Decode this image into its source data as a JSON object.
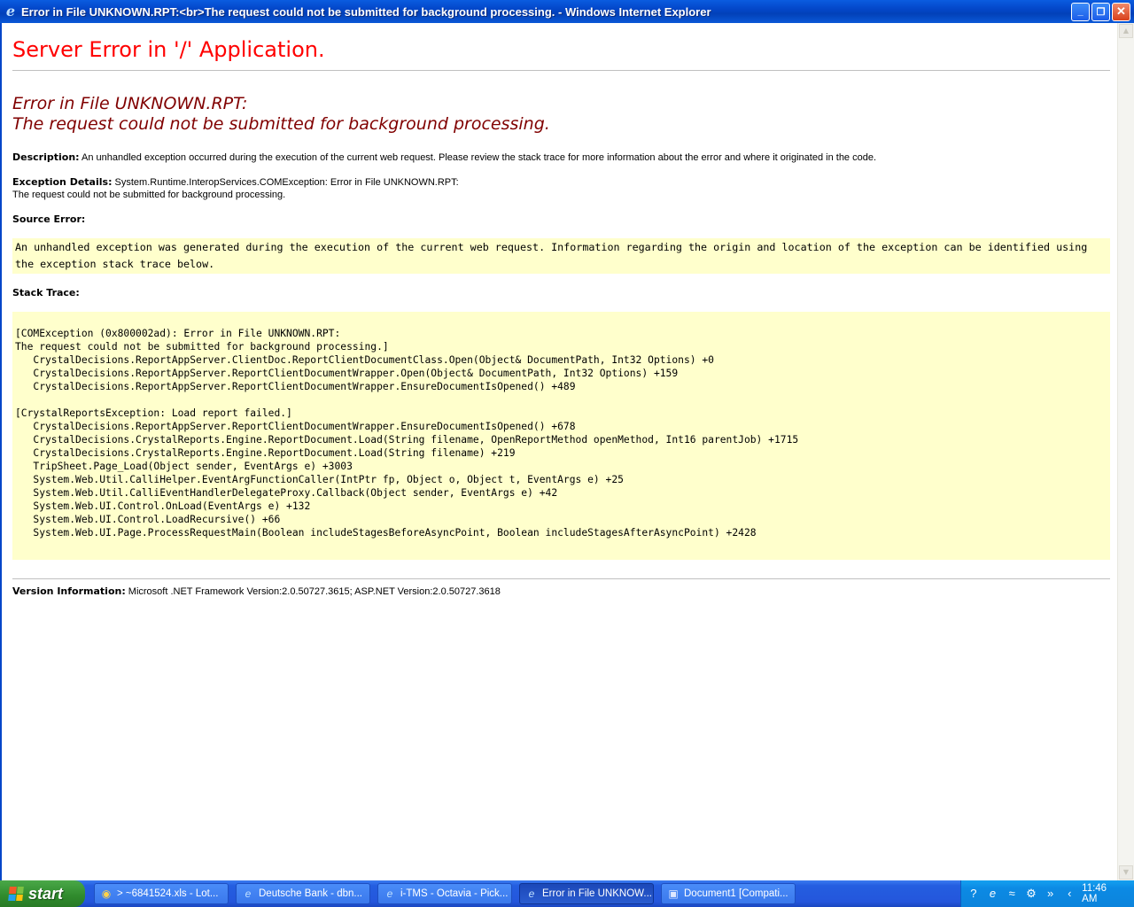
{
  "window": {
    "title": "Error in File UNKNOWN.RPT:<br>The request could not be submitted for background processing. - Windows Internet Explorer",
    "buttons": {
      "minimize": "_",
      "restore": "❐",
      "close": "✕"
    }
  },
  "page": {
    "server_error": "Server Error in '/' Application.",
    "error_title_line1": "Error in File UNKNOWN.RPT:",
    "error_title_line2": "The request could not be submitted for background processing.",
    "description_label": "Description:",
    "description_text": " An unhandled exception occurred during the execution of the current web request. Please review the stack trace for more information about the error and where it originated in the code.",
    "exception_label": "Exception Details:",
    "exception_text_line1": " System.Runtime.InteropServices.COMException: Error in File UNKNOWN.RPT:",
    "exception_text_line2": "The request could not be submitted for background processing.",
    "source_error_label": "Source Error:",
    "source_error_text": "An unhandled exception was generated during the execution of the current web request. Information regarding the origin and location of the exception can be identified using the exception stack trace below.",
    "stack_trace_label": "Stack Trace:",
    "stack_trace": "[COMException (0x800002ad): Error in File UNKNOWN.RPT:\nThe request could not be submitted for background processing.]\n   CrystalDecisions.ReportAppServer.ClientDoc.ReportClientDocumentClass.Open(Object& DocumentPath, Int32 Options) +0\n   CrystalDecisions.ReportAppServer.ReportClientDocumentWrapper.Open(Object& DocumentPath, Int32 Options) +159\n   CrystalDecisions.ReportAppServer.ReportClientDocumentWrapper.EnsureDocumentIsOpened() +489\n\n[CrystalReportsException: Load report failed.]\n   CrystalDecisions.ReportAppServer.ReportClientDocumentWrapper.EnsureDocumentIsOpened() +678\n   CrystalDecisions.CrystalReports.Engine.ReportDocument.Load(String filename, OpenReportMethod openMethod, Int16 parentJob) +1715\n   CrystalDecisions.CrystalReports.Engine.ReportDocument.Load(String filename) +219\n   TripSheet.Page_Load(Object sender, EventArgs e) +3003\n   System.Web.Util.CalliHelper.EventArgFunctionCaller(IntPtr fp, Object o, Object t, EventArgs e) +25\n   System.Web.Util.CalliEventHandlerDelegateProxy.Callback(Object sender, EventArgs e) +42\n   System.Web.UI.Control.OnLoad(EventArgs e) +132\n   System.Web.UI.Control.LoadRecursive() +66\n   System.Web.UI.Page.ProcessRequestMain(Boolean includeStagesBeforeAsyncPoint, Boolean includeStagesAfterAsyncPoint) +2428",
    "version_label": "Version Information:",
    "version_text": " Microsoft .NET Framework Version:2.0.50727.3615; ASP.NET Version:2.0.50727.3618"
  },
  "taskbar": {
    "start_label": "start",
    "tasks": [
      {
        "label": "> ~6841524.xls - Lot...",
        "icon": "spreadsheet-icon"
      },
      {
        "label": "Deutsche Bank - dbn...",
        "icon": "ie-icon"
      },
      {
        "label": "i-TMS - Octavia - Pick...",
        "icon": "ie-icon"
      },
      {
        "label": "Error in File UNKNOW...",
        "icon": "ie-icon"
      },
      {
        "label": "Document1 [Compati...",
        "icon": "word-icon"
      }
    ],
    "clock": "11:46 AM"
  },
  "colors": {
    "title_bar": "#0346c8",
    "server_error_red": "#ff0000",
    "error_title_maroon": "#800000",
    "code_background": "#ffffcc",
    "taskbar_blue": "#245ee0",
    "start_green": "#2f8a2c"
  }
}
